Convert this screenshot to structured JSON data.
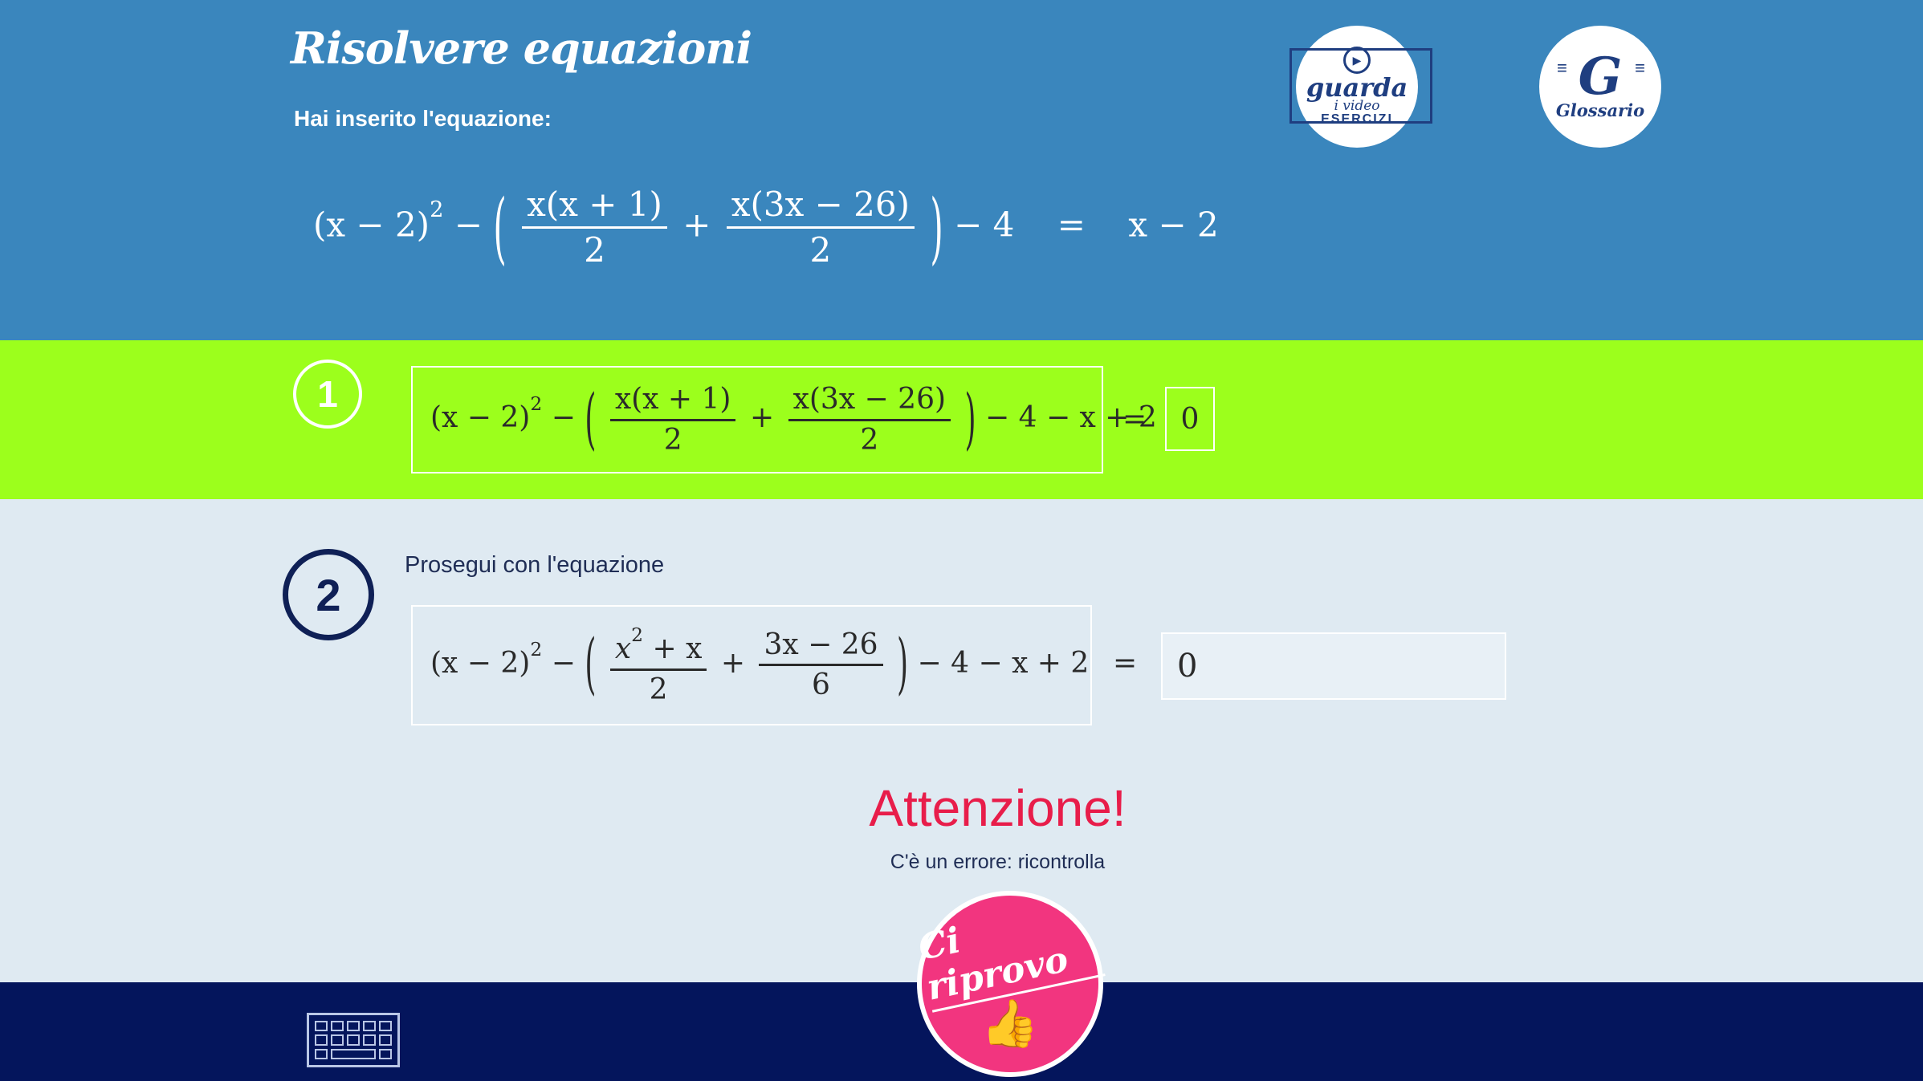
{
  "header": {
    "title": "Risolvere equazioni",
    "intro_label": "Hai inserito l'equazione:",
    "video_button": {
      "line1": "guarda",
      "line2": "i video",
      "line3": "ESERCIZI"
    },
    "glossary_button": {
      "letter": "G",
      "label": "Glossario"
    }
  },
  "equation_main": {
    "t1": "(x − 2)",
    "p1": "2",
    "t2": "−",
    "f1_num": "x(x + 1)",
    "f1_den": "2",
    "plus": "+",
    "f2_num": "x(3x − 26)",
    "f2_den": "2",
    "t3": "− 4",
    "eq": "=",
    "rhs": "x − 2"
  },
  "step1": {
    "number": "1",
    "t1": "(x − 2)",
    "p1": "2",
    "t2": "−",
    "f1_num": "x(x + 1)",
    "f1_den": "2",
    "plus": "+",
    "f2_num": "x(3x − 26)",
    "f2_den": "2",
    "t3": "− 4 − x + 2",
    "eq": "=",
    "rhs": "0"
  },
  "step2": {
    "number": "2",
    "label": "Prosegui con l'equazione",
    "t1": "(x − 2)",
    "p1": "2",
    "t2": "−",
    "f1_num_a": "x",
    "f1_num_p": "2",
    "f1_num_b": " + x",
    "f1_den": "2",
    "plus": "+",
    "f2_num": "3x − 26",
    "f2_den": "6",
    "t3": "− 4 − x + 2",
    "eq": "=",
    "answer_value": "0"
  },
  "feedback": {
    "title": "Attenzione!",
    "message": "C'è un errore: ricontrolla"
  },
  "footer": {
    "retry_label": "Ci riprovo",
    "thumb": "👍"
  },
  "colors": {
    "header_bg": "#3a86bd",
    "step1_bg": "#9cff1c",
    "step2_bg": "#dfeaf2",
    "footer_bg": "#04155c",
    "alert": "#e81d4a",
    "retry_button": "#f2357f"
  },
  "icons": {
    "video": "play-icon",
    "glossary": "glossary-g-icon",
    "keyboard": "keyboard-icon",
    "retry": "thumbs-up-icon"
  }
}
